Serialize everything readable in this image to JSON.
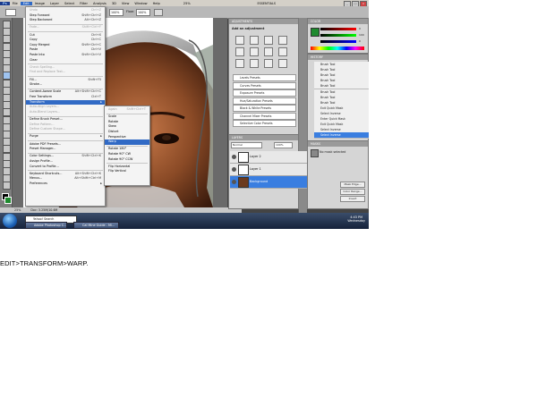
{
  "menubar": {
    "items": [
      "File",
      "Edit",
      "Image",
      "Layer",
      "Select",
      "Filter",
      "Analysis",
      "3D",
      "View",
      "Window",
      "Help"
    ],
    "active_index": 1,
    "workspace": "ESSENTIALS",
    "zoom": "25%"
  },
  "options_bar": {
    "mode_label": "Mode:",
    "mode_value": "Normal",
    "opacity_label": "Opacity:",
    "opacity_value": "100%",
    "flow_label": "Flow:",
    "flow_value": "100%"
  },
  "edit_menu": {
    "items": [
      {
        "label": "Undo",
        "shortcut": "Ctrl+Z",
        "disabled": true
      },
      {
        "label": "Step Forward",
        "shortcut": "Shift+Ctrl+Z",
        "disabled": false
      },
      {
        "label": "Step Backward",
        "shortcut": "Alt+Ctrl+Z",
        "disabled": false
      },
      {
        "sep": true
      },
      {
        "label": "Fade...",
        "shortcut": "Shift+Ctrl+F",
        "disabled": true
      },
      {
        "sep": true
      },
      {
        "label": "Cut",
        "shortcut": "Ctrl+X",
        "disabled": false
      },
      {
        "label": "Copy",
        "shortcut": "Ctrl+C",
        "disabled": false
      },
      {
        "label": "Copy Merged",
        "shortcut": "Shift+Ctrl+C",
        "disabled": false
      },
      {
        "label": "Paste",
        "shortcut": "Ctrl+V",
        "disabled": false
      },
      {
        "label": "Paste Into",
        "shortcut": "Shift+Ctrl+V",
        "disabled": false
      },
      {
        "label": "Clear",
        "shortcut": "",
        "disabled": false
      },
      {
        "sep": true
      },
      {
        "label": "Check Spelling...",
        "shortcut": "",
        "disabled": true
      },
      {
        "label": "Find and Replace Text...",
        "shortcut": "",
        "disabled": true
      },
      {
        "sep": true
      },
      {
        "label": "Fill...",
        "shortcut": "Shift+F5",
        "disabled": false
      },
      {
        "label": "Stroke...",
        "shortcut": "",
        "disabled": false
      },
      {
        "sep": true
      },
      {
        "label": "Content-Aware Scale",
        "shortcut": "Alt+Shift+Ctrl+C",
        "disabled": false
      },
      {
        "label": "Free Transform",
        "shortcut": "Ctrl+T",
        "disabled": false
      },
      {
        "label": "Transform",
        "shortcut": "",
        "disabled": false,
        "highlight": true,
        "submenu": true
      },
      {
        "label": "Auto-Align Layers...",
        "shortcut": "",
        "disabled": true
      },
      {
        "label": "Auto-Blend Layers...",
        "shortcut": "",
        "disabled": true
      },
      {
        "sep": true
      },
      {
        "label": "Define Brush Preset...",
        "shortcut": "",
        "disabled": false
      },
      {
        "label": "Define Pattern...",
        "shortcut": "",
        "disabled": true
      },
      {
        "label": "Define Custom Shape...",
        "shortcut": "",
        "disabled": true
      },
      {
        "sep": true
      },
      {
        "label": "Purge",
        "shortcut": "",
        "disabled": false,
        "submenu": true
      },
      {
        "sep": true
      },
      {
        "label": "Adobe PDF Presets...",
        "shortcut": "",
        "disabled": false
      },
      {
        "label": "Preset Manager...",
        "shortcut": "",
        "disabled": false
      },
      {
        "sep": true
      },
      {
        "label": "Color Settings...",
        "shortcut": "Shift+Ctrl+K",
        "disabled": false
      },
      {
        "label": "Assign Profile...",
        "shortcut": "",
        "disabled": false
      },
      {
        "label": "Convert to Profile...",
        "shortcut": "",
        "disabled": false
      },
      {
        "sep": true
      },
      {
        "label": "Keyboard Shortcuts...",
        "shortcut": "Alt+Shift+Ctrl+K",
        "disabled": false
      },
      {
        "label": "Menus...",
        "shortcut": "Alt+Shift+Ctrl+M",
        "disabled": false
      },
      {
        "label": "Preferences",
        "shortcut": "",
        "disabled": false,
        "submenu": true
      }
    ]
  },
  "transform_menu": {
    "items": [
      {
        "label": "Again",
        "shortcut": "Shift+Ctrl+T",
        "disabled": true
      },
      {
        "sep": true
      },
      {
        "label": "Scale",
        "shortcut": "",
        "disabled": false
      },
      {
        "label": "Rotate",
        "shortcut": "",
        "disabled": false
      },
      {
        "label": "Skew",
        "shortcut": "",
        "disabled": false
      },
      {
        "label": "Distort",
        "shortcut": "",
        "disabled": false
      },
      {
        "label": "Perspective",
        "shortcut": "",
        "disabled": false
      },
      {
        "label": "Warp",
        "shortcut": "",
        "disabled": false,
        "highlight": true
      },
      {
        "sep": true
      },
      {
        "label": "Rotate 180°",
        "shortcut": "",
        "disabled": false
      },
      {
        "label": "Rotate 90° CW",
        "shortcut": "",
        "disabled": false
      },
      {
        "label": "Rotate 90° CCW",
        "shortcut": "",
        "disabled": false
      },
      {
        "sep": true
      },
      {
        "label": "Flip Horizontal",
        "shortcut": "",
        "disabled": false
      },
      {
        "label": "Flip Vertical",
        "shortcut": "",
        "disabled": false
      }
    ]
  },
  "adjustments_panel": {
    "tabs": [
      "ADJUSTMENTS",
      "MASKS"
    ],
    "heading": "Add an adjustment",
    "presets": [
      "Levels Presets",
      "Curves Presets",
      "Exposure Presets",
      "Hue/Saturation Presets",
      "Black & White Presets",
      "Channel Mixer Presets",
      "Selective Color Presets"
    ]
  },
  "layers_panel": {
    "tabs": [
      "LAYERS",
      "CHANNELS",
      "PATHS"
    ],
    "blend_mode": "Normal",
    "opacity": "100%",
    "layers": [
      {
        "name": "Layer 2",
        "selected": false
      },
      {
        "name": "Layer 1",
        "selected": false
      },
      {
        "name": "Background",
        "selected": true
      }
    ]
  },
  "color_panel": {
    "tabs": [
      "COLOR",
      "SWATCHES",
      "STYLES"
    ],
    "values": [
      "0",
      "100",
      "0"
    ]
  },
  "history_panel": {
    "tabs": [
      "HISTORY",
      "ACTIONS"
    ],
    "items": [
      {
        "label": "Brush Tool",
        "selected": false
      },
      {
        "label": "Brush Tool",
        "selected": false
      },
      {
        "label": "Brush Tool",
        "selected": false
      },
      {
        "label": "Brush Tool",
        "selected": false
      },
      {
        "label": "Brush Tool",
        "selected": false
      },
      {
        "label": "Brush Tool",
        "selected": false
      },
      {
        "label": "Brush Tool",
        "selected": false
      },
      {
        "label": "Brush Tool",
        "selected": false
      },
      {
        "label": "Exit Quick Mask",
        "selected": false
      },
      {
        "label": "Select Inverse",
        "selected": false
      },
      {
        "label": "Enter Quick Mask",
        "selected": false
      },
      {
        "label": "Exit Quick Mask",
        "selected": false
      },
      {
        "label": "Select Inverse",
        "selected": false
      },
      {
        "label": "Select Inverse",
        "selected": true
      }
    ]
  },
  "masks_panel": {
    "tabs": [
      "MASKS"
    ],
    "heading": "No mask selected",
    "buttons": [
      "Mask Edge...",
      "Color Range...",
      "Invert"
    ]
  },
  "status": {
    "zoom": "25%",
    "doc": "Doc: 3.25M/10.6M"
  },
  "taskbar": {
    "search_text": "Yahoo! Search",
    "tasks": [
      "Adobe Photoshop C...",
      "Cal Mine Guide - Mi..."
    ],
    "time": "4:43 PM",
    "day": "Wednesday"
  },
  "caption": "EDIT>TRANSFORM>WARP.",
  "colors": {
    "highlight": "#316ac5",
    "layer_selected": "#3a7ee0",
    "foreground": "#000000",
    "background_color": "#1e8a2e"
  }
}
